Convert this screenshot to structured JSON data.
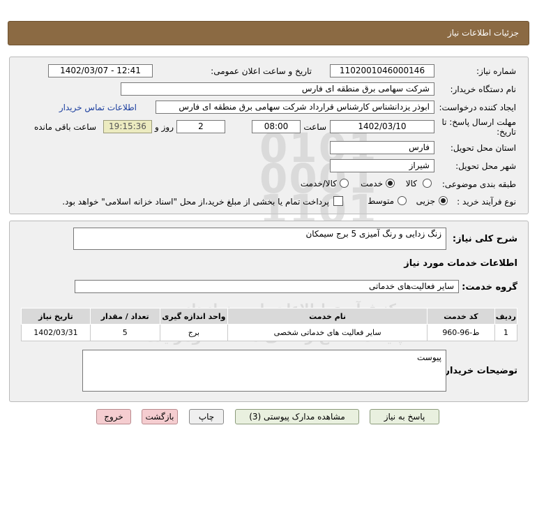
{
  "header": {
    "title": "جزئیات اطلاعات نیاز"
  },
  "form": {
    "need_number_label": "شماره نیاز:",
    "need_number": "1102001046000146",
    "announce_label": "تاریخ و ساعت اعلان عمومی:",
    "announce_value": "1402/03/07 - 12:41",
    "buyer_org_label": "نام دستگاه خریدار:",
    "buyer_org": "شرکت سهامی برق منطقه ای فارس",
    "creator_label": "ایجاد کننده درخواست:",
    "creator": "ابوذر  یزدانشناس کارشناس قرارداد شرکت سهامی برق منطقه ای فارس",
    "contact_link": "اطلاعات تماس خریدار",
    "deadline_label_1": "مهلت ارسال پاسخ: تا",
    "deadline_label_2": "تاریخ:",
    "deadline_date": "1402/03/10",
    "time_label": "ساعت",
    "deadline_time": "08:00",
    "days_value": "2",
    "days_label": "روز و",
    "remaining_time": "19:15:36",
    "remaining_label": "ساعت باقی مانده",
    "province_label": "استان محل تحویل:",
    "province": "فارس",
    "city_label": "شهر محل تحویل:",
    "city": "شیراز",
    "category_label": "طبقه بندی موضوعی:",
    "category_options": [
      "کالا",
      "خدمت",
      "کالا/خدمت"
    ],
    "category_selected": "خدمت",
    "process_label": "نوع فرآیند خرید :",
    "process_options": [
      "جزیی",
      "متوسط"
    ],
    "process_selected": "جزیی",
    "payment_note": "پرداخت تمام یا بخشی از مبلغ خرید،از محل \"اسناد خزانه اسلامی\" خواهد بود."
  },
  "details": {
    "summary_label": "شرح کلی نیاز:",
    "summary": "زنگ زدایی و رنگ آمیزی 5 برج سیمکان",
    "services_heading": "اطلاعات خدمات مورد نیاز",
    "service_group_label": "گروه خدمت:",
    "service_group": "سایر فعالیت‌های خدماتی",
    "table": {
      "headers": [
        "ردیف",
        "کد خدمت",
        "نام خدمت",
        "واحد اندازه گیری",
        "تعداد / مقدار",
        "تاریخ نیاز"
      ],
      "rows": [
        [
          "1",
          "ط-96-960",
          "سایر فعالیت های خدماتی شخصی",
          "برج",
          "5",
          "1402/03/31"
        ]
      ]
    },
    "buyer_notes_label": "توضیحات خریدار:",
    "buyer_notes": "پیوست"
  },
  "buttons": {
    "reply": "پاسخ به نیاز",
    "view_docs": "مشاهده مدارک پیوستی (3)",
    "print": "چاپ",
    "back": "بازگشت",
    "exit": "خروج"
  },
  "watermark": {
    "brand": "ParsNamadData",
    "line1": "مرکز فرآوری اطلاعات پارس نماد داده",
    "line2": "پایگاه اطلاع رسانی مناقصه ومزایده",
    "phone": "۰۲۱-۸۸۳۴۹۶۷۰-۵"
  },
  "colors": {
    "header": "#8b6a43",
    "remaining_bg": "#ecebc0",
    "link": "#1a3d9e",
    "exit_btn": "#f5cdd0"
  }
}
